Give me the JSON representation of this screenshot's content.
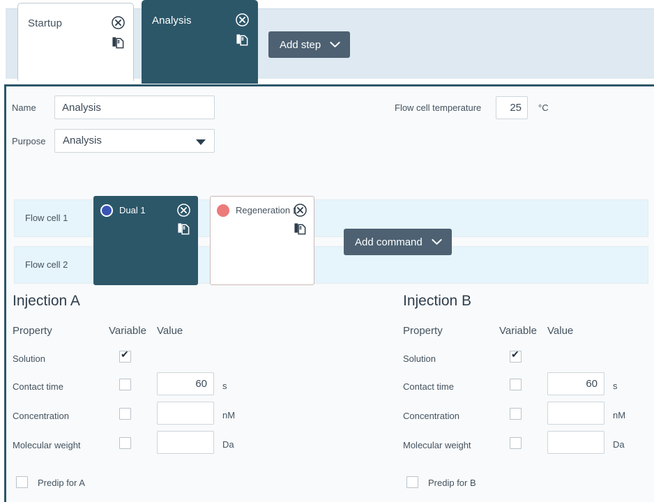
{
  "toolbar": {
    "add_step_label": "Add step",
    "add_step_icon": "chevron-down-icon",
    "add_command_label": "Add command",
    "add_command_icon": "chevron-down-icon",
    "button_color": "#4d6172"
  },
  "step_tabs": [
    {
      "label": "Startup",
      "active": false,
      "close_icon": "circle-x-icon",
      "copy_icon": "duplicate-icon"
    },
    {
      "label": "Analysis",
      "active": true,
      "close_icon": "circle-x-icon",
      "copy_icon": "duplicate-icon"
    }
  ],
  "step_form": {
    "name_label": "Name",
    "name_value": "Analysis",
    "purpose_label": "Purpose",
    "purpose_value": "Analysis",
    "purpose_caret_icon": "caret-down-icon",
    "flow_cell_temperature_label": "Flow cell temperature",
    "flow_cell_temperature_value": "25",
    "flow_cell_temperature_unit": "°C"
  },
  "flow_cells": [
    {
      "label": "Flow cell 1"
    },
    {
      "label": "Flow cell 2"
    }
  ],
  "commands": [
    {
      "label": "Dual 1",
      "selected": true,
      "dot_color": "#3b55b5",
      "dot_icon": "command-type-dot",
      "close_icon": "circle-x-icon",
      "copy_icon": "duplicate-icon"
    },
    {
      "label": "Regeneration 1",
      "selected": false,
      "dot_color": "#ec7b7b",
      "dot_icon": "command-type-dot",
      "close_icon": "circle-x-icon",
      "copy_icon": "duplicate-icon"
    }
  ],
  "injections": [
    {
      "heading": "Injection A",
      "columns": {
        "property": "Property",
        "variable": "Variable",
        "value": "Value"
      },
      "rows": [
        {
          "property": "Solution",
          "variable_checked": true,
          "has_value_input": false,
          "value": "",
          "unit": ""
        },
        {
          "property": "Contact time",
          "variable_checked": false,
          "has_value_input": true,
          "value": "60",
          "unit": "s"
        },
        {
          "property": "Concentration",
          "variable_checked": false,
          "has_value_input": true,
          "value": "",
          "unit": "nM"
        },
        {
          "property": "Molecular weight",
          "variable_checked": false,
          "has_value_input": true,
          "value": "",
          "unit": "Da"
        }
      ],
      "predip": {
        "label": "Predip for A",
        "checked": false
      }
    },
    {
      "heading": "Injection B",
      "columns": {
        "property": "Property",
        "variable": "Variable",
        "value": "Value"
      },
      "rows": [
        {
          "property": "Solution",
          "variable_checked": true,
          "has_value_input": false,
          "value": "",
          "unit": ""
        },
        {
          "property": "Contact time",
          "variable_checked": false,
          "has_value_input": true,
          "value": "60",
          "unit": "s"
        },
        {
          "property": "Concentration",
          "variable_checked": false,
          "has_value_input": true,
          "value": "",
          "unit": "nM"
        },
        {
          "property": "Molecular weight",
          "variable_checked": false,
          "has_value_input": true,
          "value": "",
          "unit": "Da"
        }
      ],
      "predip": {
        "label": "Predip for B",
        "checked": false
      }
    }
  ],
  "colors": {
    "accent_teal": "#2c5769",
    "tab_strip_bg": "#dee9f1",
    "flow_cell_row_bg": "#e6f4fb",
    "panel_bg": "#f8fafb"
  }
}
